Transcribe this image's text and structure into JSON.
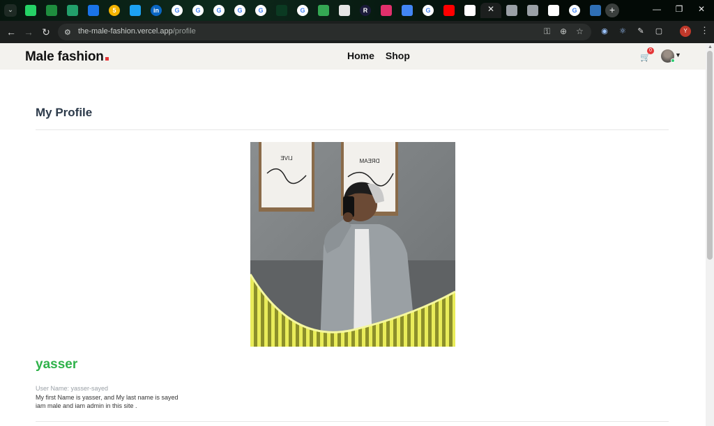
{
  "browser": {
    "url_domain": "the-male-fashion.vercel.app",
    "url_path": "/profile",
    "tabs": [
      {
        "icon": "whatsapp-icon",
        "color": "#25d366"
      },
      {
        "icon": "drive-icon",
        "color": "#1e8e3e"
      },
      {
        "icon": "code-icon",
        "color": "#22a06b"
      },
      {
        "icon": "info-icon",
        "color": "#1a73e8"
      },
      {
        "icon": "number-icon",
        "color": "#f4b400",
        "text": "5"
      },
      {
        "icon": "bubble-icon",
        "color": "#1da1f2"
      },
      {
        "icon": "linkedin-icon",
        "color": "#0a66c2",
        "text": "in"
      },
      {
        "icon": "google-icon",
        "color": "#ffffff",
        "text": "G"
      },
      {
        "icon": "google-icon",
        "color": "#ffffff",
        "text": "G"
      },
      {
        "icon": "google-icon",
        "color": "#ffffff",
        "text": "G"
      },
      {
        "icon": "google-icon",
        "color": "#ffffff",
        "text": "G"
      },
      {
        "icon": "google-icon",
        "color": "#ffffff",
        "text": "G"
      },
      {
        "icon": "blank-icon",
        "color": "#0b3a22"
      },
      {
        "icon": "google-icon",
        "color": "#ffffff",
        "text": "G"
      },
      {
        "icon": "google-drive-icon",
        "color": "#34a853"
      },
      {
        "icon": "chatgpt-icon",
        "color": "#e5e5e5"
      },
      {
        "icon": "r-icon",
        "color": "#1b1b3a",
        "text": "R"
      },
      {
        "icon": "instagram-icon",
        "color": "#e1306c"
      },
      {
        "icon": "translate-icon",
        "color": "#4285f4"
      },
      {
        "icon": "google-icon",
        "color": "#ffffff",
        "text": "G"
      },
      {
        "icon": "youtube-icon",
        "color": "#ff0000"
      },
      {
        "icon": "github-icon",
        "color": "#ffffff"
      },
      {
        "icon": "close-icon",
        "color": "#1c1f1e",
        "active": true
      },
      {
        "icon": "globe-icon",
        "color": "#9aa0a6"
      },
      {
        "icon": "globe-icon",
        "color": "#9aa0a6"
      },
      {
        "icon": "github-icon",
        "color": "#ffffff"
      },
      {
        "icon": "google-icon",
        "color": "#ffffff",
        "text": "G"
      },
      {
        "icon": "window-icon",
        "color": "#2f6fb5"
      }
    ]
  },
  "site": {
    "logo": "Male fashion",
    "nav": [
      "Home",
      "Shop"
    ],
    "cart_count": "0"
  },
  "profile": {
    "title": "My Profile",
    "name": "yasser",
    "username": "User Name: yasser-sayed",
    "bio_line1": "My first Name is yasser, and My last name is sayed",
    "bio_line2": "iam male and iam admin in this site .",
    "poster_left": "LIVE",
    "poster_right": "DREAM"
  },
  "colors": {
    "accent": "#e53637",
    "name": "#2fb24a",
    "title": "#2c3a4a"
  }
}
